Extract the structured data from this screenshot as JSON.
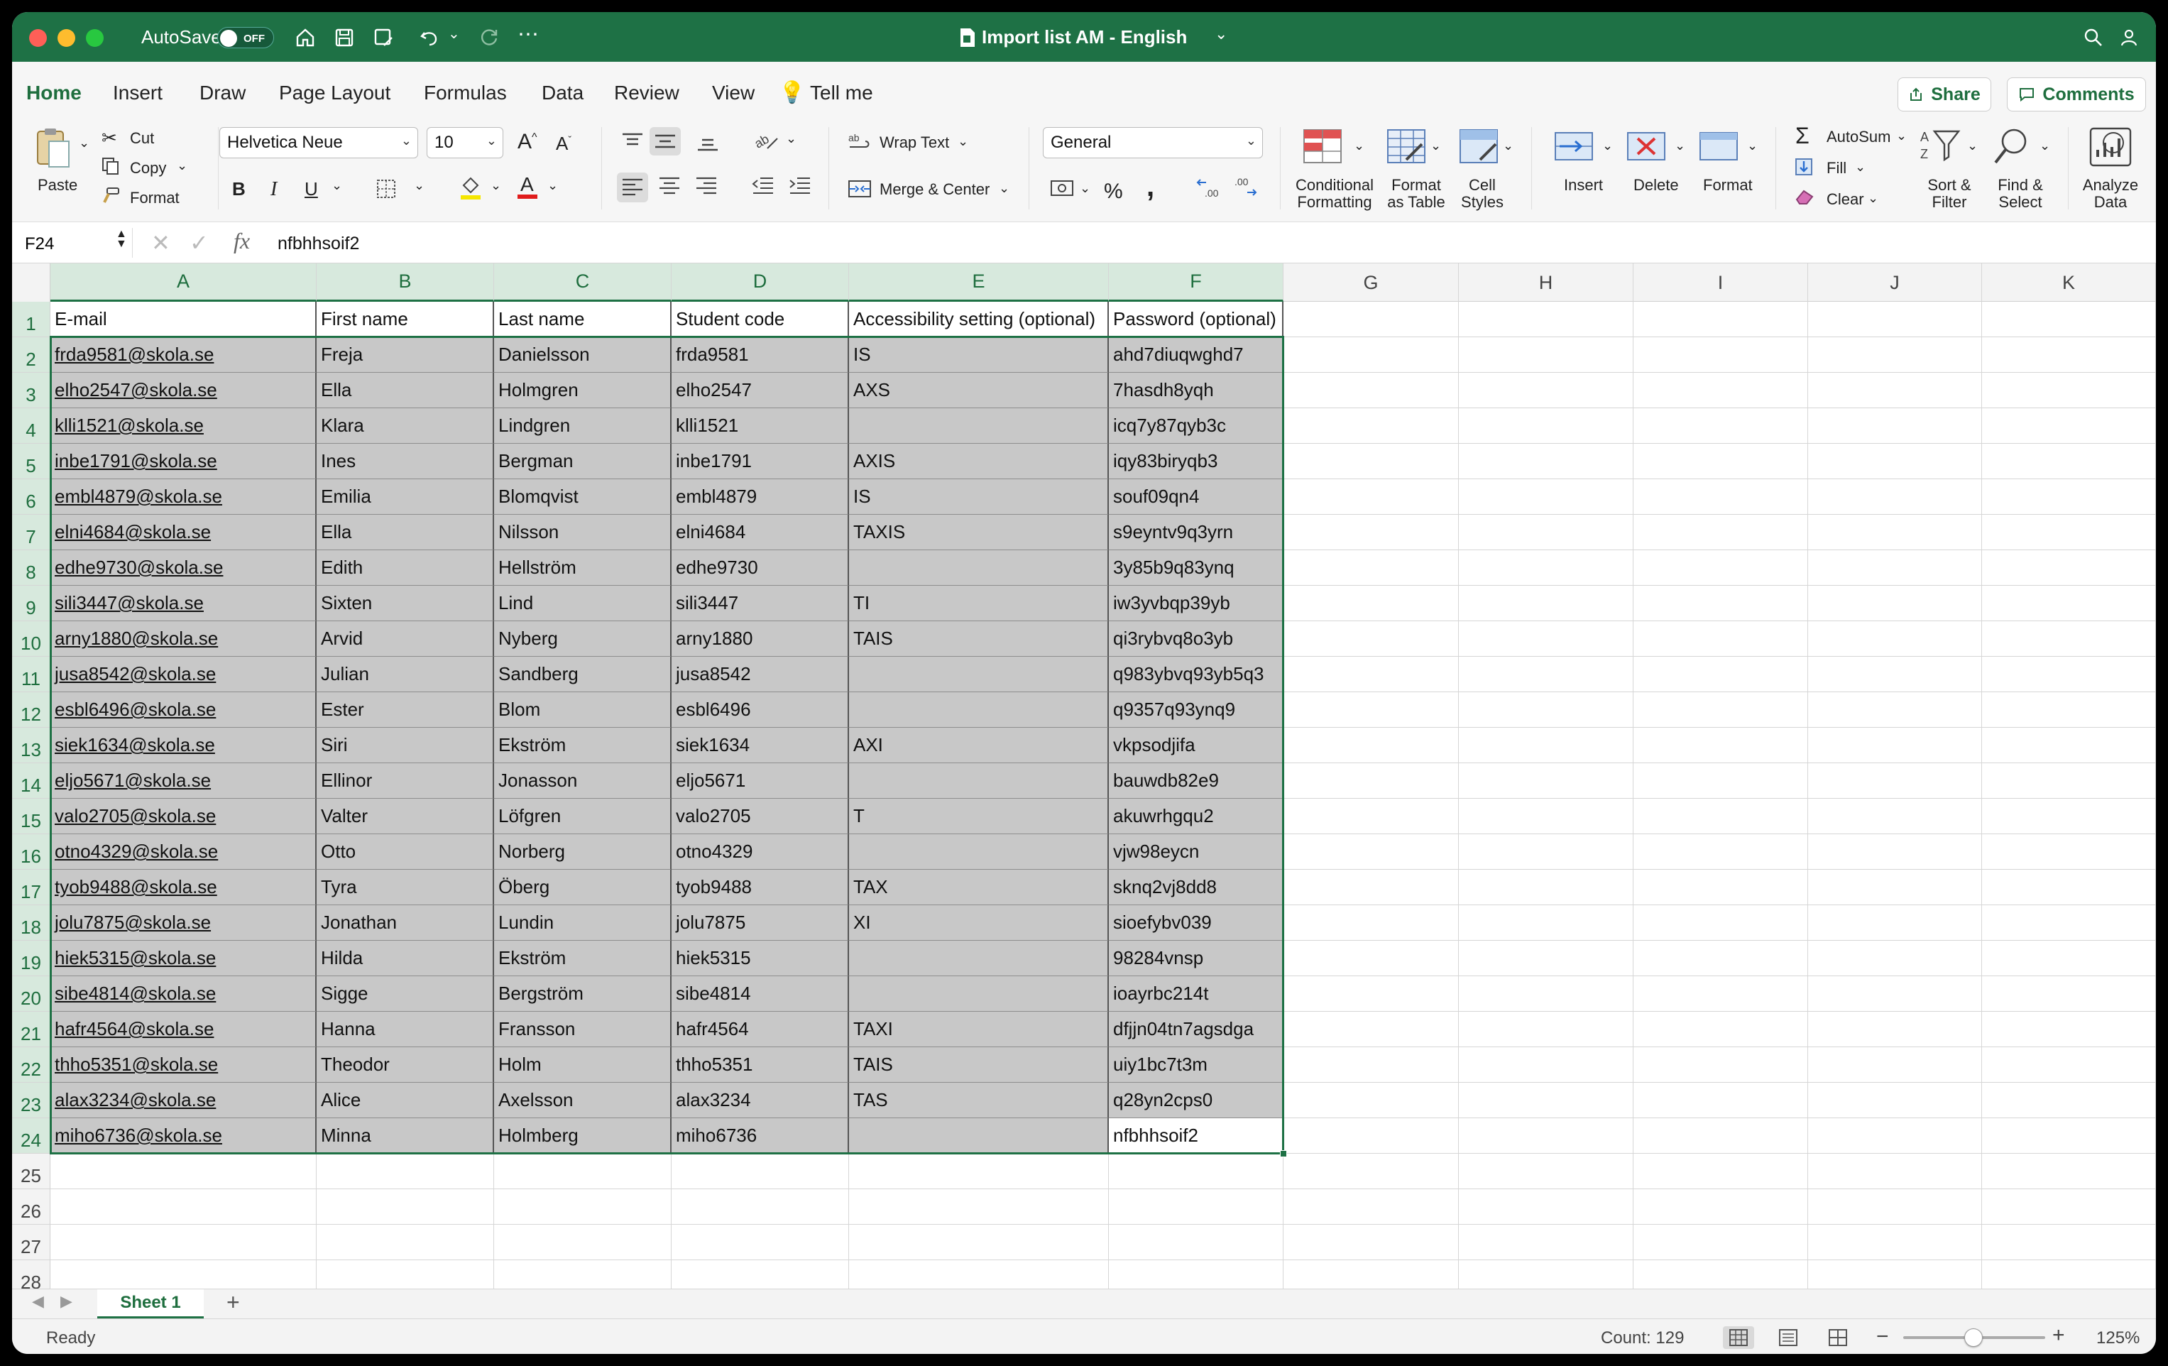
{
  "window": {
    "title": "Import list AM - English",
    "autosave_label": "AutoSave",
    "autosave_state": "OFF"
  },
  "ribbon_tabs": [
    "Home",
    "Insert",
    "Draw",
    "Page Layout",
    "Formulas",
    "Data",
    "Review",
    "View"
  ],
  "tell_me": "Tell me",
  "share_label": "Share",
  "comments_label": "Comments",
  "ribbon": {
    "paste": "Paste",
    "cut": "Cut",
    "copy": "Copy",
    "format_painter": "Format",
    "font_name": "Helvetica Neue",
    "font_size": "10",
    "bold": "B",
    "italic": "I",
    "underline": "U",
    "wrap_text": "Wrap Text",
    "merge_center": "Merge & Center",
    "number_format": "General",
    "percent": "%",
    "comma": ",",
    "conditional_formatting": "Conditional\nFormatting",
    "format_as_table": "Format\nas Table",
    "cell_styles": "Cell\nStyles",
    "insert": "Insert",
    "delete": "Delete",
    "format": "Format",
    "autosum": "AutoSum",
    "fill": "Fill",
    "clear": "Clear",
    "sort_filter": "Sort &\nFilter",
    "find_select": "Find &\nSelect",
    "analyze_data": "Analyze\nData"
  },
  "formula_bar": {
    "name_box": "F24",
    "value": "nfbhhsoif2"
  },
  "columns": [
    "A",
    "B",
    "C",
    "D",
    "E",
    "F",
    "G",
    "H",
    "I",
    "J",
    "K"
  ],
  "row_numbers": [
    "1",
    "2",
    "3",
    "4",
    "5",
    "6",
    "7",
    "8",
    "9",
    "10",
    "11",
    "12",
    "13",
    "14",
    "15",
    "16",
    "17",
    "18",
    "19",
    "20",
    "21",
    "22",
    "23",
    "24",
    "25",
    "26",
    "27",
    "28"
  ],
  "table": {
    "headers": [
      "E-mail",
      "First name",
      "Last name",
      "Student code",
      "Accessibility setting (optional)",
      "Password (optional)"
    ],
    "rows": [
      [
        "frda9581@skola.se",
        "Freja",
        "Danielsson",
        "frda9581",
        "IS",
        "ahd7diuqwghd7"
      ],
      [
        "elho2547@skola.se",
        "Ella",
        "Holmgren",
        "elho2547",
        "AXS",
        "7hasdh8yqh"
      ],
      [
        "klli1521@skola.se",
        "Klara",
        "Lindgren",
        "klli1521",
        "",
        "icq7y87qyb3c"
      ],
      [
        "inbe1791@skola.se",
        "Ines",
        "Bergman",
        "inbe1791",
        "AXIS",
        "iqy83biryqb3"
      ],
      [
        "embl4879@skola.se",
        "Emilia",
        "Blomqvist",
        "embl4879",
        "IS",
        "souf09qn4"
      ],
      [
        "elni4684@skola.se",
        "Ella",
        "Nilsson",
        "elni4684",
        "TAXIS",
        "s9eyntv9q3yrn"
      ],
      [
        "edhe9730@skola.se",
        "Edith",
        "Hellström",
        "edhe9730",
        "",
        "3y85b9q83ynq"
      ],
      [
        "sili3447@skola.se",
        "Sixten",
        "Lind",
        "sili3447",
        "TI",
        "iw3yvbqp39yb"
      ],
      [
        "arny1880@skola.se",
        "Arvid",
        "Nyberg",
        "arny1880",
        "TAIS",
        "qi3rybvq8o3yb"
      ],
      [
        "jusa8542@skola.se",
        "Julian",
        "Sandberg",
        "jusa8542",
        "",
        "q983ybvq93yb5q3"
      ],
      [
        "esbl6496@skola.se",
        "Ester",
        "Blom",
        "esbl6496",
        "",
        "q9357q93ynq9"
      ],
      [
        "siek1634@skola.se",
        "Siri",
        "Ekström",
        "siek1634",
        "AXI",
        "vkpsodjifa"
      ],
      [
        "eljo5671@skola.se",
        "Ellinor",
        "Jonasson",
        "eljo5671",
        "",
        "bauwdb82e9"
      ],
      [
        "valo2705@skola.se",
        "Valter",
        "Löfgren",
        "valo2705",
        "T",
        "akuwrhgqu2"
      ],
      [
        "otno4329@skola.se",
        "Otto",
        "Norberg",
        "otno4329",
        "",
        "vjw98eycn"
      ],
      [
        "tyob9488@skola.se",
        "Tyra",
        "Öberg",
        "tyob9488",
        "TAX",
        "sknq2vj8dd8"
      ],
      [
        "jolu7875@skola.se",
        "Jonathan",
        "Lundin",
        "jolu7875",
        "XI",
        "sioefybv039"
      ],
      [
        "hiek5315@skola.se",
        "Hilda",
        "Ekström",
        "hiek5315",
        "",
        "98284vnsp"
      ],
      [
        "sibe4814@skola.se",
        "Sigge",
        "Bergström",
        "sibe4814",
        "",
        "ioayrbc214t"
      ],
      [
        "hafr4564@skola.se",
        "Hanna",
        "Fransson",
        "hafr4564",
        "TAXI",
        "dfjjn04tn7agsdga"
      ],
      [
        "thho5351@skola.se",
        "Theodor",
        "Holm",
        "thho5351",
        "TAIS",
        "uiy1bc7t3m"
      ],
      [
        "alax3234@skola.se",
        "Alice",
        "Axelsson",
        "alax3234",
        "TAS",
        "q28yn2cps0"
      ],
      [
        "miho6736@skola.se",
        "Minna",
        "Holmberg",
        "miho6736",
        "",
        "nfbhhsoif2"
      ]
    ]
  },
  "sheet_tab": "Sheet 1",
  "status": {
    "ready": "Ready",
    "count": "Count: 129",
    "zoom": "125%"
  },
  "colors": {
    "accent": "#1e7145",
    "selection_fill": "#c8c8c8"
  }
}
